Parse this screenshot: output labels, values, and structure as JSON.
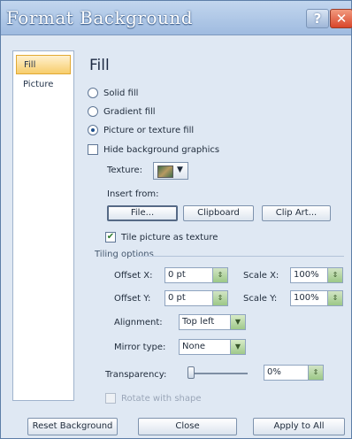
{
  "window": {
    "title": "Format Background",
    "help_glyph": "?",
    "close_glyph": "✕"
  },
  "sidebar": {
    "items": [
      {
        "label": "Fill",
        "active": true
      },
      {
        "label": "Picture",
        "active": false
      }
    ]
  },
  "fill": {
    "heading": "Fill",
    "options": [
      {
        "label": "Solid fill",
        "selected": false
      },
      {
        "label": "Gradient fill",
        "selected": false
      },
      {
        "label": "Picture or texture fill",
        "selected": true
      }
    ],
    "hide_background_graphics": {
      "label": "Hide background graphics",
      "checked": false
    },
    "texture_label": "Texture:",
    "texture_arrow": "▼",
    "insert_from_label": "Insert from:",
    "insert_buttons": {
      "file": "File...",
      "clipboard": "Clipboard",
      "clip_art": "Clip Art..."
    },
    "tile_texture": {
      "label": "Tile picture as texture",
      "checked": true,
      "mark": "✔"
    }
  },
  "tiling": {
    "group_title": "Tiling options",
    "offset_x": {
      "label": "Offset X:",
      "value": "0 pt"
    },
    "offset_y": {
      "label": "Offset Y:",
      "value": "0 pt"
    },
    "scale_x": {
      "label": "Scale X:",
      "value": "100%"
    },
    "scale_y": {
      "label": "Scale Y:",
      "value": "100%"
    },
    "alignment": {
      "label": "Alignment:",
      "value": "Top left"
    },
    "mirror_type": {
      "label": "Mirror type:",
      "value": "None"
    },
    "spin_glyph": "⇕",
    "dropdown_glyph": "▼"
  },
  "transparency": {
    "label": "Transparency:",
    "value": "0%",
    "level": 0
  },
  "rotate_with_shape": {
    "label": "Rotate with shape",
    "checked": false,
    "enabled": false
  },
  "footer": {
    "reset": "Reset Background",
    "close": "Close",
    "apply_all": "Apply to All"
  }
}
